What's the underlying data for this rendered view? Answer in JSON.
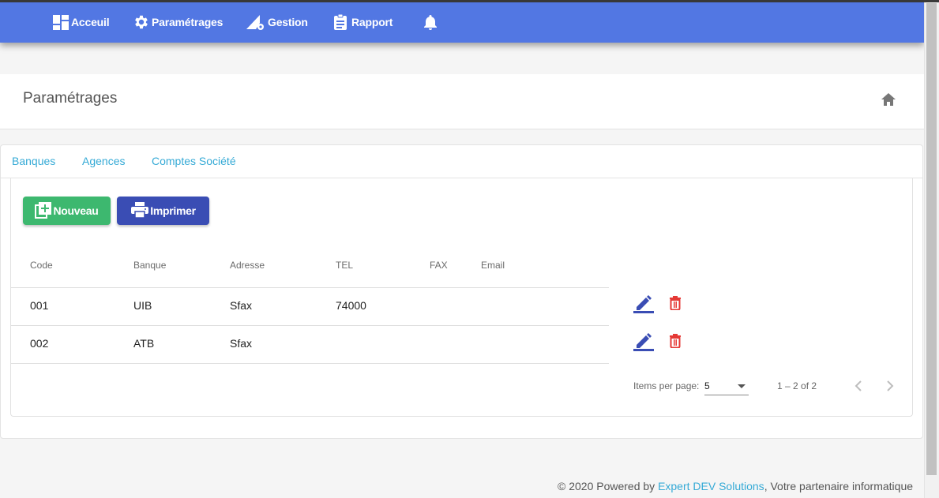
{
  "nav": {
    "items": [
      {
        "label": "Acceuil",
        "icon": "dashboard-icon"
      },
      {
        "label": "Paramétrages",
        "icon": "gear-icon"
      },
      {
        "label": "Gestion",
        "icon": "triangle-settings-icon"
      },
      {
        "label": "Rapport",
        "icon": "clipboard-icon"
      }
    ],
    "bell_icon": "bell-icon"
  },
  "header": {
    "title": "Paramétrages",
    "home_icon": "home-icon"
  },
  "tabs": [
    "Banques",
    "Agences",
    "Comptes Société"
  ],
  "toolbar": {
    "new_label": "Nouveau",
    "print_label": "Imprimer"
  },
  "table": {
    "columns": [
      "Code",
      "Banque",
      "Adresse",
      "TEL",
      "FAX",
      "Email"
    ],
    "rows": [
      {
        "code": "001",
        "banque": "UIB",
        "adresse": "Sfax",
        "tel": "74000",
        "fax": "",
        "email": ""
      },
      {
        "code": "002",
        "banque": "ATB",
        "adresse": "Sfax",
        "tel": "",
        "fax": "",
        "email": ""
      }
    ]
  },
  "paginator": {
    "items_per_page_label": "Items per page:",
    "page_size": "5",
    "range": "1 – 2 of 2"
  },
  "footer": {
    "prefix": "© 2020 Powered by ",
    "company": "Expert DEV Solutions",
    "suffix": ", Votre partenaire informatique"
  },
  "colors": {
    "navbar": "#5277e3",
    "accent_link": "#35aad6",
    "new_button": "#3db86f",
    "print_button": "#3a4db4",
    "edit_icon": "#3a4db4",
    "delete_icon": "#e53935"
  }
}
